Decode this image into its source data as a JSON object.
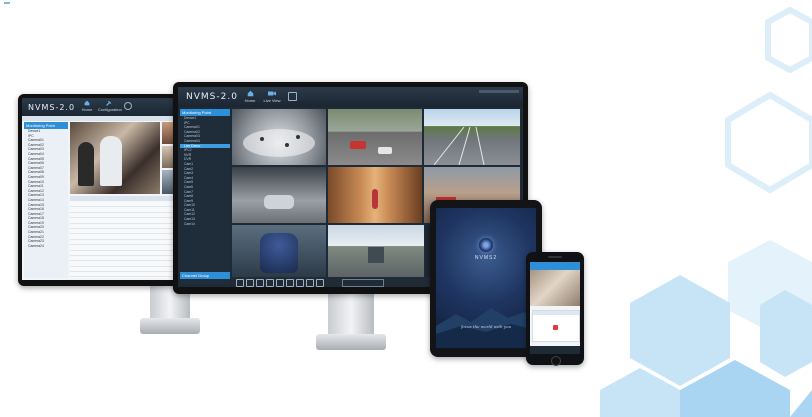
{
  "colors": {
    "hex_light": "#dff0fb",
    "hex_mid": "#b7dcf4",
    "hex_strong": "#9fd0f0",
    "accent": "#2f8fd6"
  },
  "desktop_main": {
    "brand": "NVMS-2.0",
    "toolbar": [
      {
        "label": "Home",
        "icon": "home-icon"
      },
      {
        "label": "Live View",
        "icon": "camera-icon"
      },
      {
        "label": "",
        "icon": "add-tab-icon"
      }
    ],
    "sidebar_title": "Monitoring Point",
    "sidebar_footer": "Channel Group",
    "tree_items": [
      "Device1",
      "IPC",
      "Camera01",
      "Camera02",
      "Camera03",
      "Camera04",
      "Live Demo",
      "IPC2",
      "NVR",
      "DVR",
      "Cam1",
      "Cam2",
      "Cam3",
      "Cam4",
      "Cam5",
      "Cam6",
      "Cam7",
      "Cam8",
      "Cam9",
      "Cam10",
      "Cam11",
      "Cam12",
      "Cam13",
      "Cam14"
    ]
  },
  "desktop_left": {
    "brand": "NVMS-2.0",
    "toolbar": [
      {
        "label": "Home",
        "icon": "home-icon"
      },
      {
        "label": "Configuration",
        "icon": "tools-icon"
      }
    ],
    "sidebar_title": "Monitoring Point",
    "tree_items": [
      "Device1",
      "IPC",
      "Camera01",
      "Camera02",
      "Camera03",
      "Camera04",
      "Camera05",
      "Camera06",
      "Camera07",
      "Camera08",
      "Camera09",
      "Camera10",
      "Camera11",
      "Camera12",
      "Camera13",
      "Camera14",
      "Camera15",
      "Camera16",
      "Camera17",
      "Camera18",
      "Camera19",
      "Camera20",
      "Camera21",
      "Camera22",
      "Camera23",
      "Camera24"
    ]
  },
  "tablet": {
    "app_name": "NVMS2",
    "tagline": "focus the world with you"
  }
}
